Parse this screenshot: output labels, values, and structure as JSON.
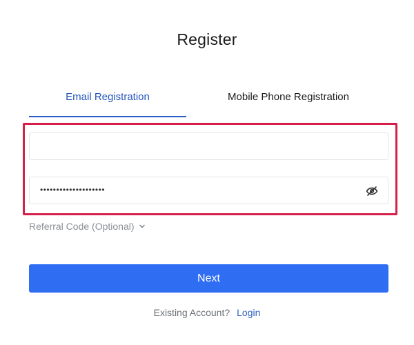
{
  "page": {
    "title": "Register"
  },
  "tabs": [
    {
      "label": "Email Registration",
      "active": true
    },
    {
      "label": "Mobile Phone Registration",
      "active": false
    }
  ],
  "form": {
    "email": {
      "value": "",
      "placeholder": ""
    },
    "password": {
      "masked_value": "••••••••••••••••••••",
      "toggle_icon": "eye-slash-icon"
    },
    "referral": {
      "label": "Referral Code (Optional)",
      "icon": "chevron-down-icon"
    },
    "next_label": "Next"
  },
  "footer": {
    "prompt": "Existing Account?",
    "login_label": "Login"
  },
  "colors": {
    "accent": "#2f6df3",
    "active_tab": "#2356b8",
    "highlight_border": "#d51f4a",
    "muted_text": "#8b8f96"
  }
}
